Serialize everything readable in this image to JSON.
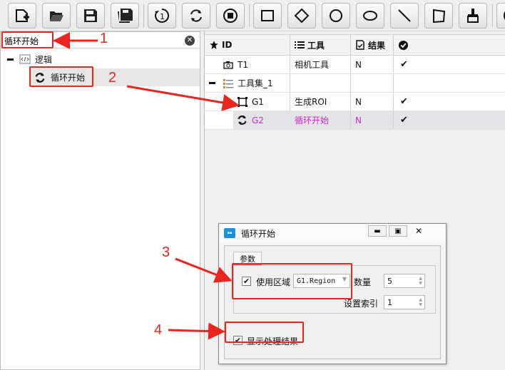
{
  "colors": {
    "annotation_red": "#e8251e",
    "selected_text": "#c829c8",
    "tab_accent": "#2bb0a0"
  },
  "toolbar": {
    "buttons": [
      {
        "name": "add-icon"
      },
      {
        "name": "open-folder-icon"
      },
      {
        "name": "save-icon"
      },
      {
        "name": "save-all-icon"
      },
      {
        "name": "run-once-icon"
      },
      {
        "name": "run-loop-icon"
      },
      {
        "name": "stop-icon"
      },
      {
        "name": "rectangle-roi-icon"
      },
      {
        "name": "rotated-rect-roi-icon"
      },
      {
        "name": "circle-roi-icon"
      },
      {
        "name": "ellipse-roi-icon"
      },
      {
        "name": "line-roi-icon"
      },
      {
        "name": "polygon-roi-icon"
      },
      {
        "name": "brush-icon"
      },
      {
        "name": "clock-icon"
      }
    ]
  },
  "search": {
    "value": "循环开始"
  },
  "tree": {
    "root_label": "逻辑",
    "child_label": "循环开始"
  },
  "grid": {
    "columns": [
      "ID",
      "工具",
      "结果",
      ""
    ],
    "rows": [
      {
        "id": "T1",
        "tool": "相机工具",
        "result": "N",
        "checked": "✔"
      },
      {
        "id": "工具集_1",
        "tool": "",
        "result": "",
        "checked": ""
      },
      {
        "id": "G1",
        "tool": "生成ROI",
        "result": "N",
        "checked": "✔"
      },
      {
        "id": "G2",
        "tool": "循环开始",
        "result": "N",
        "checked": "✔"
      }
    ]
  },
  "dialog": {
    "title": "循环开始",
    "tab_label": "参数",
    "use_region_label": "使用区域",
    "region_value": "G1.Region",
    "count_label": "数量",
    "count_value": "5",
    "index_label": "设置索引",
    "index_value": "1",
    "show_result_label": "显示处理结果",
    "checkmark": "✔"
  },
  "annotations": [
    "1",
    "2",
    "3",
    "4"
  ]
}
